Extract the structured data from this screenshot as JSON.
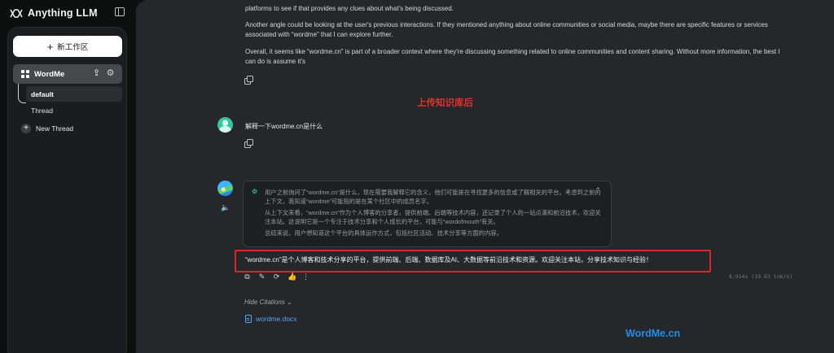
{
  "app": {
    "name": "Anything LLM",
    "logo_icon": "link-infinity-icon",
    "sidebar_toggle_icon": "sidebar-panel-icon"
  },
  "sidebar": {
    "new_workspace_label": "新工作区",
    "workspace": {
      "name": "WordMe",
      "icon": "grid-icon",
      "action_icons": [
        "upload-icon",
        "gear-icon"
      ]
    },
    "threads": [
      {
        "label": "default",
        "active": true
      },
      {
        "label": "Thread",
        "active": false
      }
    ],
    "new_thread_label": "New Thread"
  },
  "chat": {
    "previous_reply": [
      "platforms to see if that provides any clues about what's being discussed.",
      "Another angle could be looking at the user's previous interactions. If they mentioned anything about online communities or social media, maybe there are specific features or services associated with “wordme” that I can explore further.",
      "Overall, it seems like “wordme.cn” is part of a broader context where they're discussing something related to online communities and content sharing. Without more information, the best I can do is assume it's"
    ],
    "annotation": "上传知识库后",
    "user_message": "解释一下wordme.cn是什么",
    "thought": [
      "用户之前询问了“wordme.cn”是什么，现在需要我解释它的含义，他们可能是在寻找更多的信息或了解相关的平台。考虑到之前的上下文，我知道“wordme”可能指的是在某个社区中的成员名字。",
      "从上下文来看，“wordme.cn”作为个人博客的分享者，提供前端、后端等技术内容，还记录了个人的一站点滴和前沿技术，欢迎关注本站。这说明它是一个专注于技术分享和个人成长的平台，可能与“wordofmouth”有关。",
      "总结来说，用户想知道这个平台的具体运作方式，包括社区活动、技术分享等方面的内容。"
    ],
    "answer": "“wordme.cn”是个人博客和技术分享的平台，提供前端、后端、数据库及AI、大数据等前沿技术和资源。欢迎关注本站，分享技术知识与经验！",
    "action_icons": [
      "copy-icon",
      "edit-icon",
      "regenerate-icon",
      "thumbs-up-icon",
      "more-icon"
    ],
    "metrics": "8.914s (19.63 tok/s)",
    "hide_citations_label": "Hide Citations ⌄",
    "citation_file": "wordme.docx"
  },
  "watermark": "WordMe.cn",
  "colors": {
    "background": "#0e0f0f",
    "panel": "#26272b",
    "annotation_red": "#e0322f",
    "highlight_border": "#d9262b",
    "link_blue": "#5aa2f2",
    "watermark_blue": "#1f8ee8"
  }
}
